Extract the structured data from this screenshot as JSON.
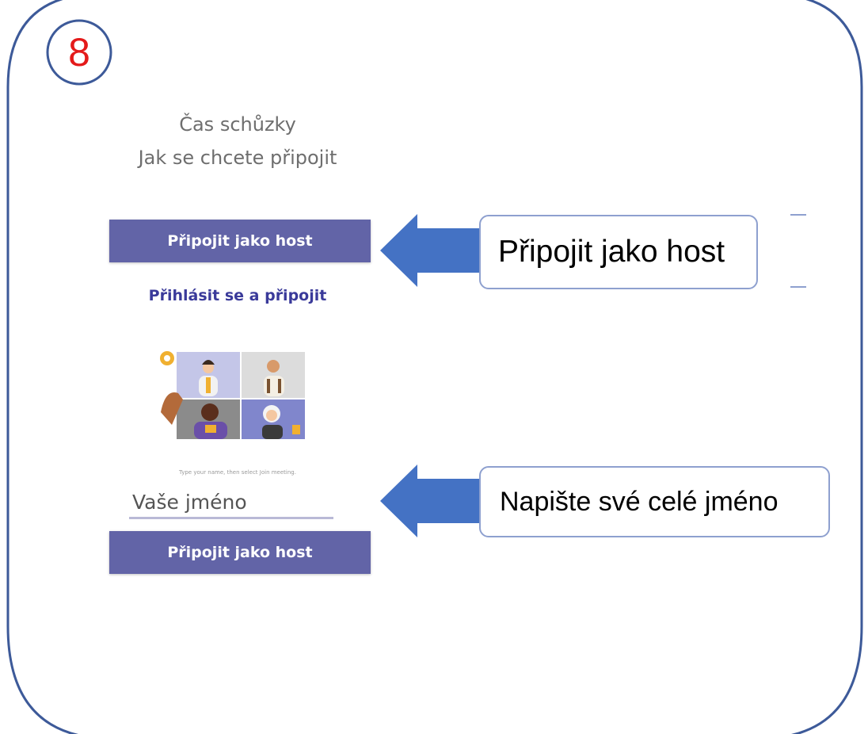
{
  "step": {
    "number": "8"
  },
  "heading": {
    "line1": "Čas schůzky",
    "line2": "Jak se chcete připojit"
  },
  "join_as_guest_top": {
    "label": "Připojit jako host"
  },
  "sign_in_link": {
    "label": "Přihlásit se a připojit"
  },
  "illustration": {
    "icon": "video-meeting-participants-illustration"
  },
  "name_form": {
    "instruction": "Type your name, then select Join meeting.",
    "input_placeholder": "Vaše jméno",
    "input_value": "",
    "join_button": "Připojit jako host"
  },
  "callouts": [
    {
      "text": "Připojit jako host",
      "arrow_icon": "arrow-left-icon"
    },
    {
      "text": "Napište své celé jméno",
      "arrow_icon": "arrow-left-icon"
    }
  ],
  "colors": {
    "button_purple": "#6264a7",
    "link_purple": "#3a3a9a",
    "arrow_blue": "#4472c4",
    "frame_blue": "#3d5a99",
    "step_red": "#e41a1a"
  }
}
